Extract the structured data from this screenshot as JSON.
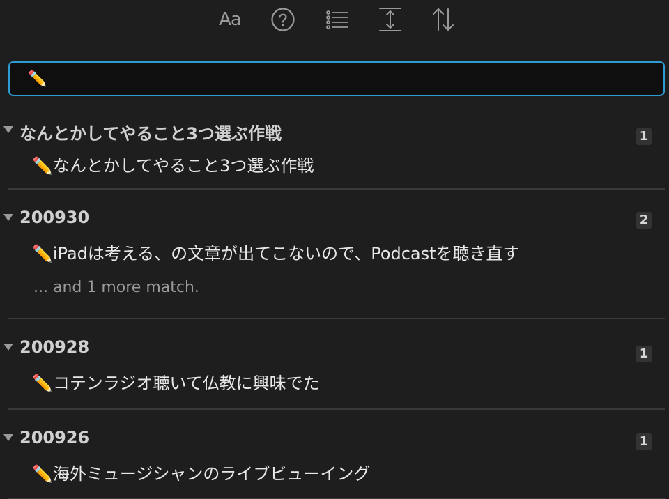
{
  "toolbar": {
    "buttons": [
      {
        "icon": "font-size-icon",
        "label": "Aa"
      },
      {
        "icon": "help-circle-icon"
      },
      {
        "icon": "list-icon"
      },
      {
        "icon": "expand-vertical-icon"
      },
      {
        "icon": "sort-icon"
      }
    ]
  },
  "search": {
    "value": "✏️",
    "accent_color": "#2e9bd2"
  },
  "results": [
    {
      "title": "なんとかしてやること3つ選ぶ作戦",
      "count": "1",
      "matches": [
        "✏️なんとかしてやること3つ選ぶ作戦"
      ]
    },
    {
      "title": "200930",
      "count": "2",
      "matches": [
        "✏️iPadは考える、の文章が出てこないので、Podcastを聴き直す"
      ],
      "more": "... and 1 more match."
    },
    {
      "title": "200928",
      "count": "1",
      "matches": [
        "✏️コテンラジオ聴いて仏教に興味でた"
      ]
    },
    {
      "title": "200926",
      "count": "1",
      "matches": [
        "✏️海外ミュージシャンのライブビューイング"
      ]
    }
  ]
}
